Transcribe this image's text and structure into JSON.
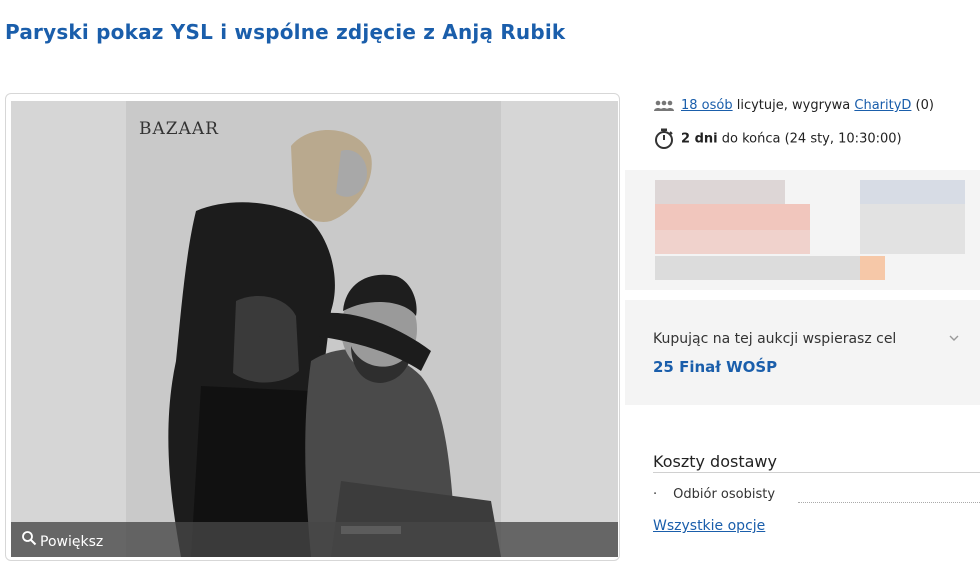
{
  "auction": {
    "title": "Paryski pokaz YSL i wspólne zdjęcie z Anją Rubik",
    "zoom_label": "Powiększ",
    "photo_caption": "BAZAAR",
    "bidders": {
      "count_link": "18 osób",
      "text_mid": " licytuje, wygrywa ",
      "winner_link": "CharityD",
      "winner_score": " (0)"
    },
    "time": {
      "bold": "2 dni",
      "rest": " do końca (24 sty, 10:30:00)"
    }
  },
  "cause": {
    "text": "Kupując na tej aukcji wspierasz cel",
    "link": "25 Finał WOŚP"
  },
  "shipping": {
    "title": "Koszty dostawy",
    "items": [
      "Odbiór osobisty"
    ],
    "all_options": "Wszystkie opcje"
  },
  "colors": {
    "link": "#1a5eab",
    "panel": "#f4f4f4"
  }
}
